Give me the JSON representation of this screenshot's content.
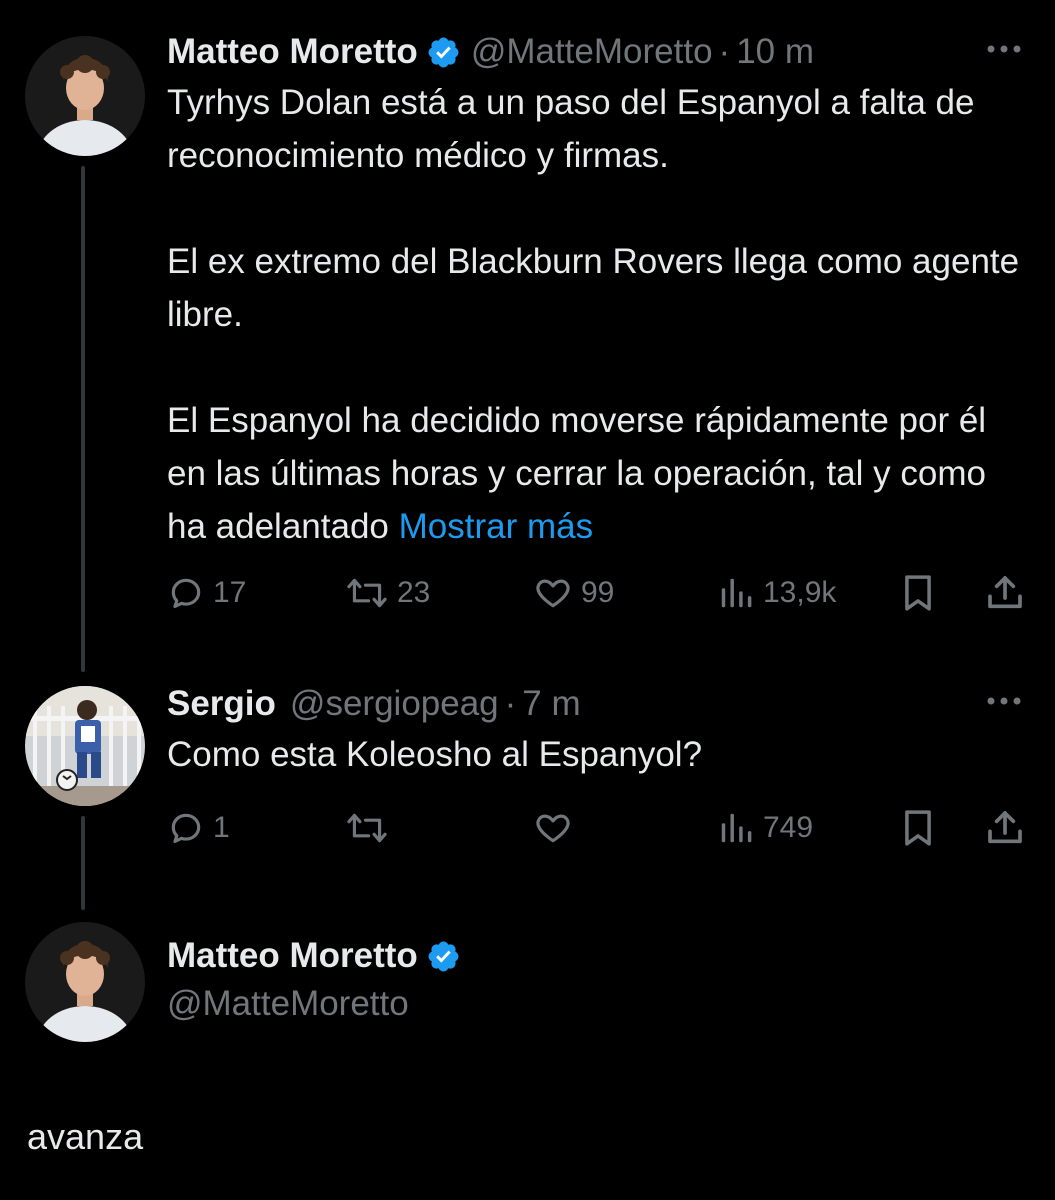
{
  "colors": {
    "background": "#000000",
    "text": "#e7e9ea",
    "muted": "#71767b",
    "link": "#1d9bf0",
    "verified": "#1d9bf0"
  },
  "tweet1": {
    "author": "Matteo Moretto",
    "verified": true,
    "handle": "@MatteMoretto",
    "time": "10 m",
    "paragraphs": [
      "Tyrhys Dolan está a un paso del Espanyol a falta de reconocimiento médico y firmas.",
      "El ex extremo del Blackburn Rovers llega como agente libre.",
      "El Espanyol ha decidido moverse rápidamente por él en las últimas horas y cerrar la operación, tal y como ha adelantado"
    ],
    "show_more": "Mostrar más",
    "replies": "17",
    "retweets": "23",
    "likes": "99",
    "views": "13,9k"
  },
  "tweet2": {
    "author": "Sergio",
    "handle": "@sergiopeag",
    "time": "7 m",
    "text": "Como esta Koleosho al Espanyol?",
    "replies": "1",
    "views": "749"
  },
  "tweet3": {
    "author": "Matteo Moretto",
    "verified": true,
    "handle": "@MatteMoretto"
  },
  "reply_text": "avanza"
}
